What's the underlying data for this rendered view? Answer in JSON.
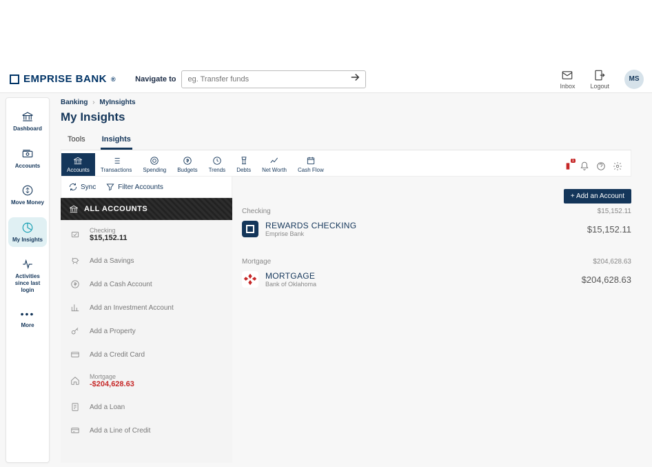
{
  "header": {
    "logo_text": "EMPRISE BANK",
    "navigate_label": "Navigate to",
    "search_placeholder": "eg. Transfer funds",
    "inbox_label": "Inbox",
    "logout_label": "Logout",
    "avatar_initials": "MS"
  },
  "leftnav": {
    "items": [
      {
        "label": "Dashboard",
        "icon": "bank-icon"
      },
      {
        "label": "Accounts",
        "icon": "money-icon"
      },
      {
        "label": "Move Money",
        "icon": "transfer-icon"
      },
      {
        "label": "My Insights",
        "icon": "pie-icon",
        "active": true
      },
      {
        "label": "Activities since last login",
        "icon": "activity-icon"
      },
      {
        "label": "More",
        "icon": "dots-icon"
      }
    ]
  },
  "breadcrumb": {
    "a": "Banking",
    "b": "MyInsights"
  },
  "page_title": "My Insights",
  "tabs": {
    "tools": "Tools",
    "insights": "Insights"
  },
  "toolbar": {
    "items": [
      {
        "label": "Accounts",
        "active": true
      },
      {
        "label": "Transactions"
      },
      {
        "label": "Spending"
      },
      {
        "label": "Budgets"
      },
      {
        "label": "Trends"
      },
      {
        "label": "Debts"
      },
      {
        "label": "Net Worth"
      },
      {
        "label": "Cash Flow"
      }
    ],
    "alert_badge": "1"
  },
  "side_actions": {
    "sync": "Sync",
    "filter": "Filter Accounts"
  },
  "all_accounts_label": "ALL ACCOUNTS",
  "side_list": {
    "checking": {
      "label": "Checking",
      "value": "$15,152.11"
    },
    "add_savings": "Add a Savings",
    "add_cash": "Add a Cash Account",
    "add_investment": "Add an Investment Account",
    "add_property": "Add a Property",
    "add_credit": "Add a Credit Card",
    "mortgage": {
      "label": "Mortgage",
      "value": "-$204,628.63"
    },
    "add_loan": "Add a Loan",
    "add_line": "Add a Line of Credit"
  },
  "add_account_btn": "+ Add an Account",
  "categories": {
    "checking": {
      "label": "Checking",
      "total": "$15,152.11"
    },
    "mortgage": {
      "label": "Mortgage",
      "total": "$204,628.63"
    }
  },
  "accounts": {
    "rewards": {
      "name": "REWARDS CHECKING",
      "bank": "Emprise Bank",
      "balance": "$15,152.11"
    },
    "mortgage": {
      "name": "MORTGAGE",
      "bank": "Bank of Oklahoma",
      "balance": "$204,628.63"
    }
  }
}
